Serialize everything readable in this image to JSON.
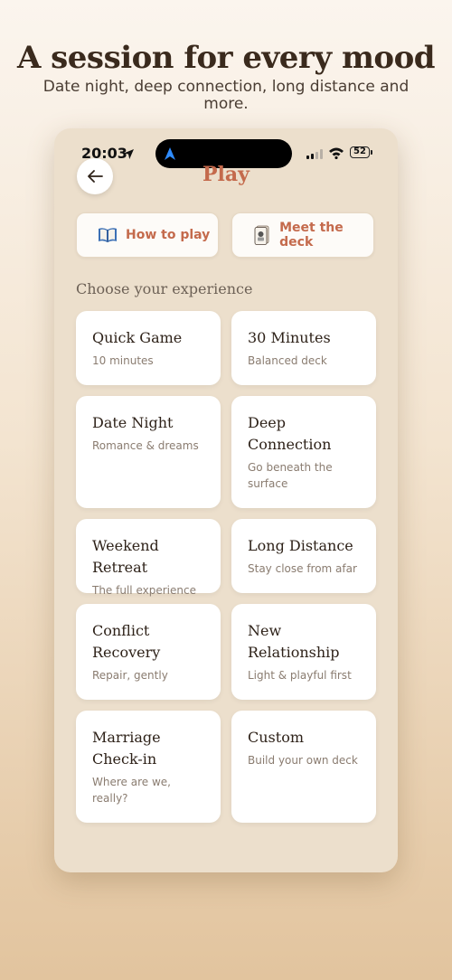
{
  "header": {
    "title": "A session for every mood",
    "subtitle": "Date night, deep connection, long distance and more."
  },
  "status_bar": {
    "time": "20:03",
    "battery": "52"
  },
  "screen": {
    "title": "Play",
    "back_icon": "arrow-left-icon",
    "buttons": [
      {
        "label": "How to play",
        "icon": "book-icon"
      },
      {
        "label": "Meet the deck",
        "icon": "card-deck-icon"
      }
    ],
    "section_label": "Choose your experience",
    "options": [
      {
        "title": "Quick Game",
        "subtitle": "10 minutes"
      },
      {
        "title": "30 Minutes",
        "subtitle": "Balanced deck"
      },
      {
        "title": "Date Night",
        "subtitle": "Romance & dreams"
      },
      {
        "title": "Deep Connection",
        "subtitle": "Go beneath the surface"
      },
      {
        "title": "Weekend Retreat",
        "subtitle": "The full experience"
      },
      {
        "title": "Long Distance",
        "subtitle": "Stay close from afar"
      },
      {
        "title": "Conflict Recovery",
        "subtitle": "Repair, gently"
      },
      {
        "title": "New Relationship",
        "subtitle": "Light & playful first"
      },
      {
        "title": "Marriage Check-in",
        "subtitle": "Where are we, really?"
      },
      {
        "title": "Custom",
        "subtitle": "Build your own deck"
      }
    ]
  },
  "colors": {
    "accent": "#c46a4c",
    "phone_bg": "#ecdfcc",
    "card_bg": "#ffffff"
  }
}
